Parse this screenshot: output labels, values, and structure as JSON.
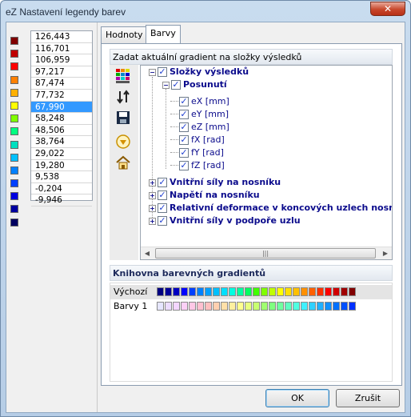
{
  "window": {
    "title": "eZ Nastavení legendy barev"
  },
  "left_panel": {
    "swatch_colors": [
      "#800000",
      "#c00000",
      "#ff0000",
      "#ff8000",
      "#ffb000",
      "#ffff00",
      "#80ff00",
      "#00ff80",
      "#00e0c0",
      "#00c0ff",
      "#0080ff",
      "#0040ff",
      "#0000e0",
      "#0000a0",
      "#000060"
    ],
    "values": [
      "126,443",
      "116,701",
      "106,959",
      "97,217",
      "87,474",
      "77,732",
      "67,990",
      "58,248",
      "48,506",
      "38,764",
      "29,022",
      "19,280",
      "9,538",
      "-0,204",
      "-9,946"
    ],
    "selected_index": 6
  },
  "tabs": [
    {
      "label": "Hodnoty",
      "active": false
    },
    {
      "label": "Barvy",
      "active": true
    }
  ],
  "gradient_group": {
    "title": "Zadat aktuální gradient na složky výsledků"
  },
  "toolbar": [
    "color-grid-icon",
    "sort-arrows-icon",
    "save-icon",
    "filter-down-icon",
    "home-icon"
  ],
  "tree": {
    "root": "Složky výsledků",
    "posunuti": "Posunutí",
    "leaves": [
      "eX [mm]",
      "eY [mm]",
      "eZ [mm]",
      "fX [rad]",
      "fY [rad]",
      "fZ [rad]"
    ],
    "others": [
      "Vnitřní síly na nosníku",
      "Napětí na nosníku",
      "Relativní deformace v koncových uzlech nosník",
      "Vnitřní síly v podpoře uzlu"
    ]
  },
  "library": {
    "title": "Knihovna barevných gradientů",
    "rows": [
      {
        "name": "Výchozí",
        "colors": [
          "#000080",
          "#000099",
          "#0000c0",
          "#0000ff",
          "#0040ff",
          "#0080ff",
          "#00a0ff",
          "#00c0ff",
          "#00e0ff",
          "#00ffe0",
          "#00ffa0",
          "#00ff60",
          "#40ff00",
          "#80ff00",
          "#c0ff00",
          "#ffff00",
          "#ffe000",
          "#ffc000",
          "#ff9000",
          "#ff6000",
          "#ff3000",
          "#ff0000",
          "#d00000",
          "#a00000",
          "#800000"
        ]
      },
      {
        "name": "Barvy 1",
        "colors": [
          "#e6e6ff",
          "#ecdcff",
          "#f4d6ff",
          "#fcd0f6",
          "#ffc8e6",
          "#ffc0d0",
          "#ffbfbf",
          "#ffd0b0",
          "#ffe0a8",
          "#fff0a0",
          "#ffff90",
          "#e8ff80",
          "#c8ff70",
          "#a0ff70",
          "#80ff80",
          "#70ffa0",
          "#60ffc0",
          "#50ffe0",
          "#40f0ff",
          "#30d0ff",
          "#20b0ff",
          "#1090ff",
          "#0070ff",
          "#0050ff",
          "#0030ff"
        ]
      }
    ]
  },
  "buttons": {
    "ok": "OK",
    "cancel": "Zrušit"
  }
}
